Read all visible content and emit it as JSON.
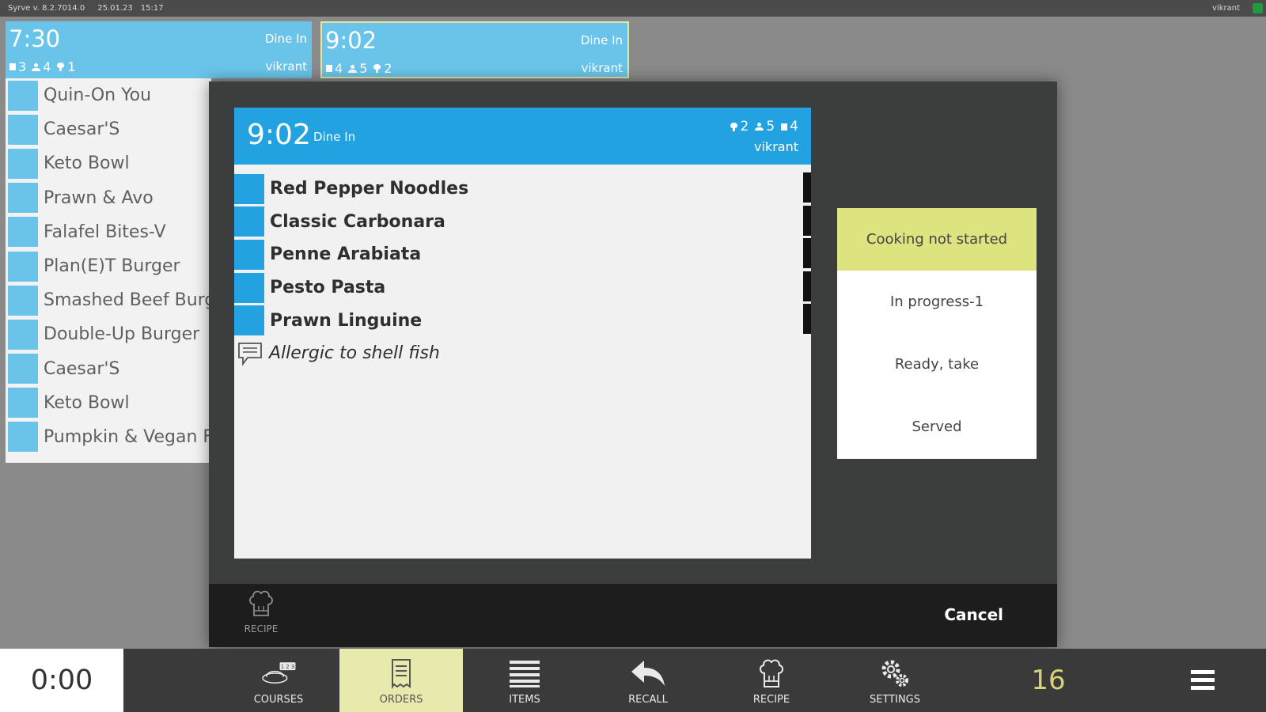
{
  "topbar": {
    "version": "Syrve v. 8.2.7014.0",
    "date": "25.01.23",
    "time": "15:17",
    "user": "vikrant"
  },
  "cards": [
    {
      "time": "7:30",
      "type": "Dine In",
      "user": "vikrant",
      "table": "3",
      "guests": "4",
      "courses": "1"
    },
    {
      "time": "9:02",
      "type": "Dine In",
      "user": "vikrant",
      "table": "4",
      "guests": "5",
      "courses": "2"
    }
  ],
  "background_items": [
    "Quin-On You",
    "Caesar'S",
    "Keto Bowl",
    "Prawn & Avo",
    "Falafel Bites-V",
    "Plan(E)T Burger",
    "Smashed Beef Burger",
    "Double-Up Burger",
    "Caesar'S",
    "Keto Bowl",
    "Pumpkin & Vegan Feta"
  ],
  "ticket": {
    "time": "9:02",
    "type": "Dine In",
    "user": "vikrant",
    "courses": "2",
    "guests": "5",
    "table": "4",
    "items": [
      "Red Pepper Noodles",
      "Classic Carbonara",
      "Penne Arabiata",
      "Pesto Pasta",
      "Prawn Linguine"
    ],
    "comment": "Allergic to shell fish"
  },
  "status_options": [
    {
      "label": "Cooking not started",
      "active": true
    },
    {
      "label": "In progress-1",
      "active": false
    },
    {
      "label": "Ready, take",
      "active": false
    },
    {
      "label": "Served",
      "active": false
    }
  ],
  "modal_footer": {
    "recipe_label": "RECIPE",
    "cancel_label": "Cancel"
  },
  "toolbar": {
    "timer": "0:00",
    "buttons": {
      "courses": "COURSES",
      "orders": "ORDERS",
      "items": "ITEMS",
      "recall": "RECALL",
      "recipe": "RECIPE",
      "settings": "SETTINGS"
    },
    "courses_badge": "1 2 3",
    "counter": "16"
  },
  "colors": {
    "ticket_header": "#22a2e0",
    "card_bg": "#6ac4ea",
    "active_status": "#dde37e",
    "active_toolbar": "#e7e9ad"
  }
}
